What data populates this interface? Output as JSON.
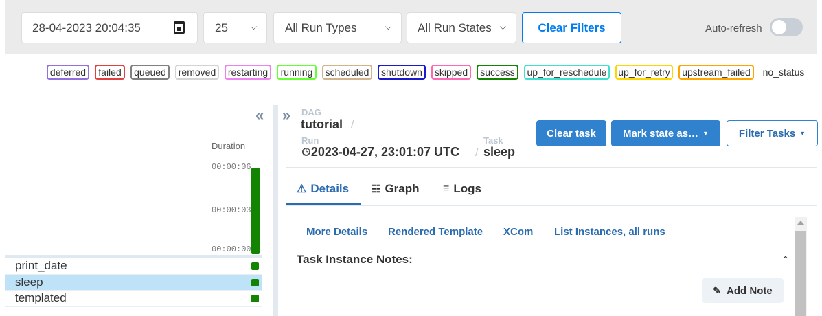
{
  "filters": {
    "datetime_value": "28-04-2023 20:04:35",
    "num_runs": "25",
    "run_types": "All Run Types",
    "run_states": "All Run States",
    "clear_filters": "Clear Filters",
    "auto_refresh_label": "Auto-refresh",
    "auto_refresh_on": false
  },
  "legend": [
    {
      "label": "deferred",
      "color": "#9370db"
    },
    {
      "label": "failed",
      "color": "#e53e3e"
    },
    {
      "label": "queued",
      "color": "#808080"
    },
    {
      "label": "removed",
      "color": "#d3d3d3"
    },
    {
      "label": "restarting",
      "color": "#ee82ee"
    },
    {
      "label": "running",
      "color": "#66ff33"
    },
    {
      "label": "scheduled",
      "color": "#d2b48c"
    },
    {
      "label": "shutdown",
      "color": "#1a1acc"
    },
    {
      "label": "skipped",
      "color": "#ff69b4"
    },
    {
      "label": "success",
      "color": "#138402"
    },
    {
      "label": "up_for_reschedule",
      "color": "#40e0d0"
    },
    {
      "label": "up_for_retry",
      "color": "#ffd700"
    },
    {
      "label": "upstream_failed",
      "color": "#ffa500"
    },
    {
      "label": "no_status",
      "color": ""
    }
  ],
  "grid": {
    "duration_label": "Duration",
    "ticks": [
      "00:00:06",
      "00:00:03",
      "00:00:00"
    ],
    "tasks": [
      {
        "name": "print_date",
        "selected": false,
        "state": "success"
      },
      {
        "name": "sleep",
        "selected": true,
        "state": "success"
      },
      {
        "name": "templated",
        "selected": false,
        "state": "success"
      }
    ]
  },
  "details": {
    "dag_label": "DAG",
    "dag_id": "tutorial",
    "run_label": "Run",
    "run_id": "2023-04-27, 23:01:07 UTC",
    "task_label": "Task",
    "task_id": "sleep",
    "buttons": {
      "clear_task": "Clear task",
      "mark_state": "Mark state as…",
      "filter_tasks": "Filter Tasks"
    },
    "tabs": [
      {
        "label": "Details",
        "active": true
      },
      {
        "label": "Graph",
        "active": false
      },
      {
        "label": "Logs",
        "active": false
      }
    ],
    "sublinks": [
      "More Details",
      "Rendered Template",
      "XCom",
      "List Instances, all runs"
    ],
    "notes_title": "Task Instance Notes:",
    "add_note": "Add Note"
  }
}
